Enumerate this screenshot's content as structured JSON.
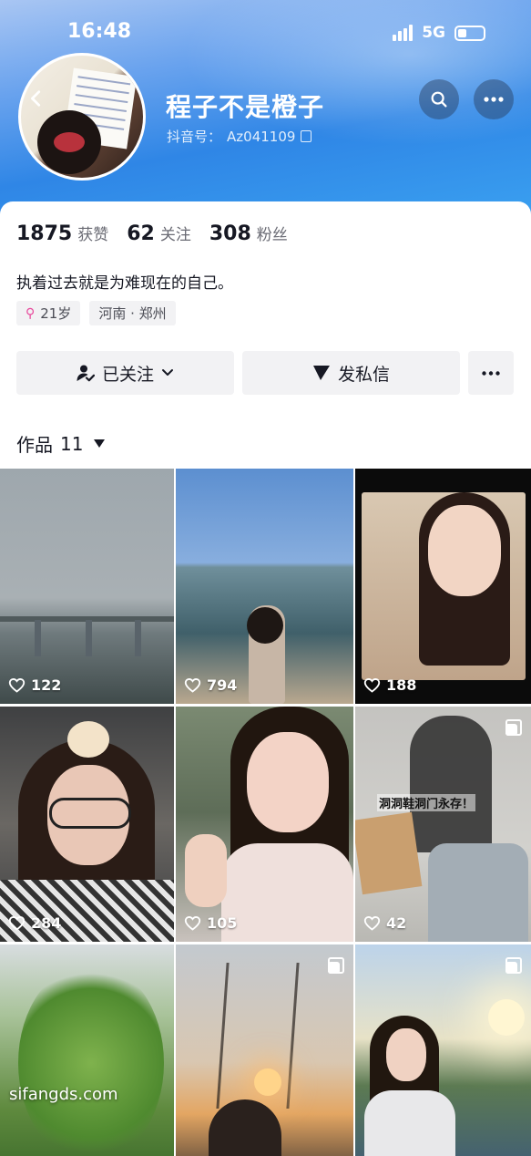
{
  "status_bar": {
    "time": "16:48",
    "network": "5G"
  },
  "profile": {
    "name": "程子不是橙子",
    "id_label": "抖音号：",
    "id_value": "Az041109",
    "stats": [
      {
        "value": "1875",
        "label": "获赞"
      },
      {
        "value": "62",
        "label": "关注"
      },
      {
        "value": "308",
        "label": "粉丝"
      }
    ],
    "bio": "执着过去就是为难现在的自己。",
    "tags": {
      "age": "21岁",
      "location": "河南 · 郑州"
    }
  },
  "actions": {
    "follow_label": "已关注",
    "message_label": "发私信"
  },
  "works": {
    "label": "作品",
    "count": "11",
    "items": [
      {
        "likes": "122",
        "multi": false
      },
      {
        "likes": "794",
        "multi": false
      },
      {
        "likes": "188",
        "multi": false
      },
      {
        "likes": "284",
        "multi": false
      },
      {
        "likes": "105",
        "multi": false
      },
      {
        "likes": "42",
        "multi": true
      },
      {
        "likes": "",
        "multi": false,
        "watermark": "sifangds.com"
      },
      {
        "likes": "",
        "multi": true
      },
      {
        "likes": "",
        "multi": true
      }
    ],
    "overlay_text": "洞洞鞋洞门永存！"
  },
  "icons": {
    "back": "back-arrow-icon",
    "search": "search-icon",
    "more": "more-dots-icon",
    "copy": "copy-icon",
    "like": "heart-outline-icon",
    "gallery": "multi-image-icon",
    "follow": "person-check-icon",
    "message": "send-plane-icon",
    "female": "female-symbol-icon"
  },
  "colors": {
    "accent_blue": "#2f86e6",
    "female_pink": "#e8479b",
    "text_primary": "#161823",
    "text_secondary": "#6a6b74",
    "button_bg": "#f2f2f4"
  }
}
